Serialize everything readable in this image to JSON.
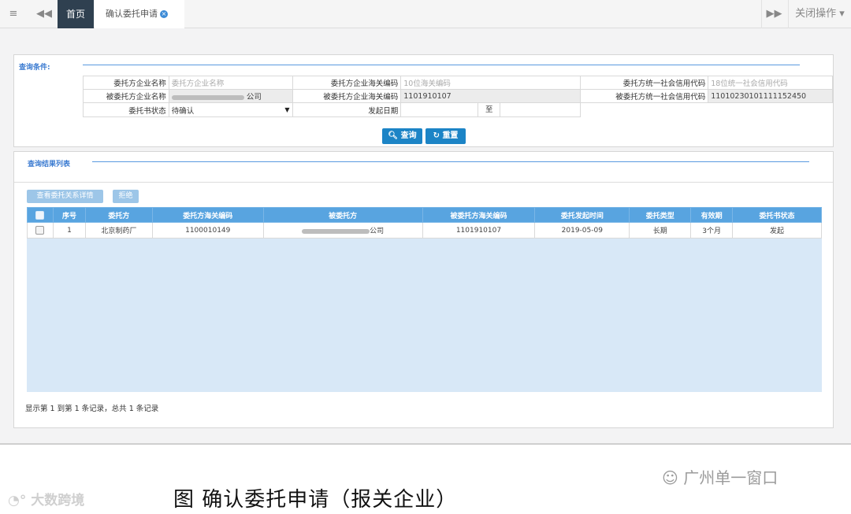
{
  "tabbar": {
    "home_tab": "首页",
    "active_tab": "确认委托申请",
    "close_ops": "关闭操作"
  },
  "query": {
    "section_title": "查询条件:",
    "row1": [
      {
        "label": "委托方企业名称",
        "value": "委托方企业名称"
      },
      {
        "label": "委托方企业海关编码",
        "value": "10位海关编码"
      },
      {
        "label": "委托方统一社会信用代码",
        "value": "18位统一社会信用代码"
      }
    ],
    "row2": [
      {
        "label": "被委托方企业名称",
        "value": "公司"
      },
      {
        "label": "被委托方企业海关编码",
        "value": "1101910107"
      },
      {
        "label": "被委托方统一社会信用代码",
        "value": "11010230101111152450"
      }
    ],
    "row3": {
      "status_label": "委托书状态",
      "status_value": "待确认",
      "date_label": "发起日期",
      "date_sep": "至"
    },
    "search_button": "查询",
    "reset_button": "重置"
  },
  "results": {
    "section_title": "查询结果列表",
    "view_detail_button": "查看委托关系详情",
    "reject_button": "拒绝",
    "columns": [
      "序号",
      "委托方",
      "委托方海关编码",
      "被委托方",
      "被委托方海关编码",
      "委托发起时间",
      "委托类型",
      "有效期",
      "委托书状态"
    ],
    "rows": [
      {
        "index": "1",
        "principal": "北京制药厂",
        "principal_code": "1100010149",
        "agent": "公司",
        "agent_code": "1101910107",
        "start_time": "2019-05-09",
        "type": "长期",
        "validity": "3个月",
        "status": "发起"
      }
    ],
    "footer": "显示第 1 到第 1 条记录，总共 1 条记录"
  },
  "caption": "图 确认委托申请（报关企业）",
  "watermark_left": "大数跨境",
  "watermark_right": "广州单一窗口"
}
